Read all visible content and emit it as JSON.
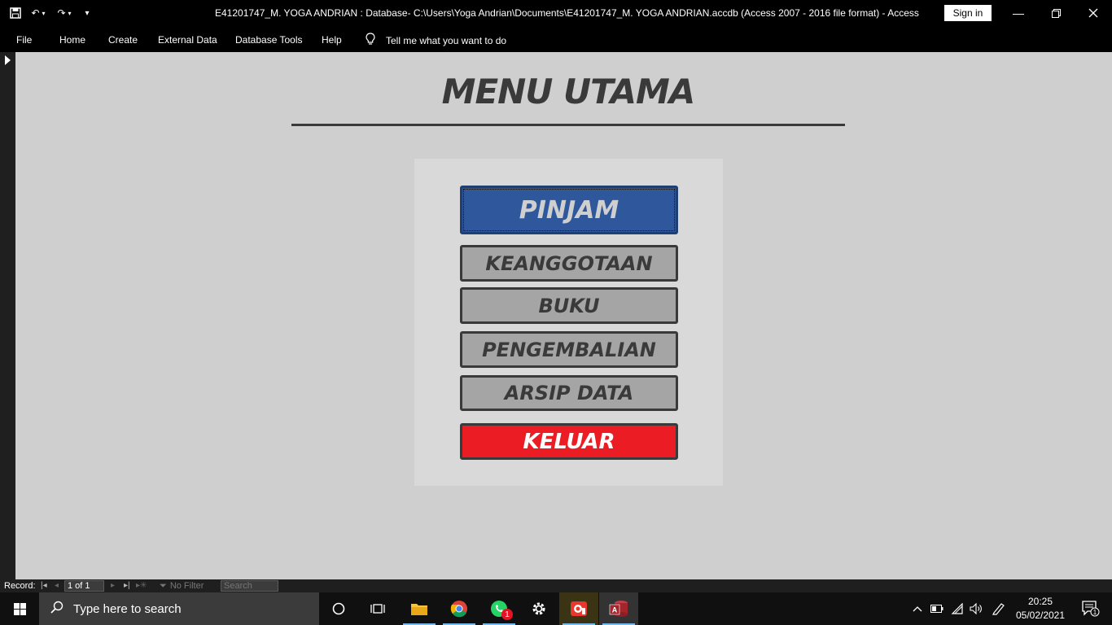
{
  "window": {
    "title": "E41201747_M. YOGA ANDRIAN : Database- C:\\Users\\Yoga Andrian\\Documents\\E41201747_M. YOGA ANDRIAN.accdb (Access 2007 - 2016 file format)  -  Access",
    "sign_in": "Sign in"
  },
  "ribbon": {
    "tabs": [
      "File",
      "Home",
      "Create",
      "External Data",
      "Database Tools",
      "Help"
    ],
    "tell_me": "Tell me what you want to do"
  },
  "form": {
    "heading": "MENU UTAMA",
    "buttons": {
      "pinjam": "PINJAM",
      "keanggotaan": "KEANGGOTAAN",
      "buku": "BUKU",
      "pengembalian": "PENGEMBALIAN",
      "arsip": "ARSIP DATA",
      "keluar": "KELUAR"
    }
  },
  "record_bar": {
    "label": "Record:",
    "position": "1 of 1",
    "filter": "No Filter",
    "search": "Search"
  },
  "taskbar": {
    "search_placeholder": "Type here to search",
    "whatsapp_badge": "1",
    "time": "20:25",
    "date": "05/02/2021",
    "notification_count": "1"
  },
  "colors": {
    "form_bg": "#d0cfd0",
    "panel_bg": "#d9d9d9",
    "pinjam": "#2f579b",
    "menu_gray": "#a5a5a5",
    "keluar": "#ec1c24"
  }
}
